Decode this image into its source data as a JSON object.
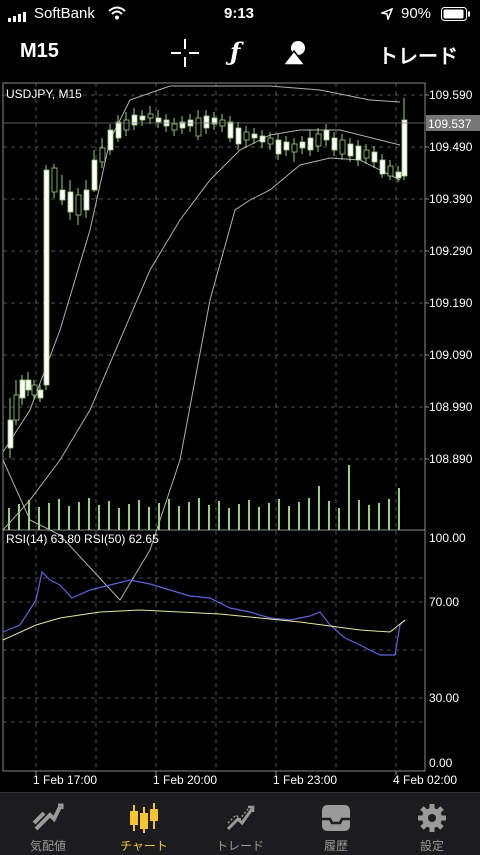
{
  "status": {
    "carrier": "SoftBank",
    "time": "9:13",
    "battery": "90%"
  },
  "toolbar": {
    "timeframe": "M15",
    "trade_label": "トレード"
  },
  "chart": {
    "symbol_label": "USDJPY, M15",
    "current_price": "109.537",
    "price_ticks": [
      "109.590",
      "109.490",
      "109.390",
      "109.290",
      "109.190",
      "109.090",
      "108.990",
      "108.890"
    ],
    "indicator_label": "RSI(14) 63.80 RSI(50) 62.65",
    "rsi_ticks": [
      "100.00",
      "70.00",
      "30.00",
      "0.00"
    ],
    "time_ticks": [
      "1 Feb 17:00",
      "1 Feb 20:00",
      "1 Feb 23:00",
      "4 Feb 02:00"
    ],
    "colors": {
      "bull": "#ffffff",
      "bear": "#000000",
      "wick": "#9ccf7a",
      "bands": "#b0b0b0",
      "volume": "#9ccf7a",
      "rsi14": "#5a66d6",
      "rsi50": "#e8e8a0",
      "grid": "#6a6a6a"
    }
  },
  "tabs": [
    {
      "label": "気配値",
      "icon": "quotes-icon"
    },
    {
      "label": "チャート",
      "icon": "chart-icon",
      "active": true
    },
    {
      "label": "トレード",
      "icon": "trade-icon"
    },
    {
      "label": "履歴",
      "icon": "history-icon"
    },
    {
      "label": "設定",
      "icon": "settings-icon"
    }
  ]
}
